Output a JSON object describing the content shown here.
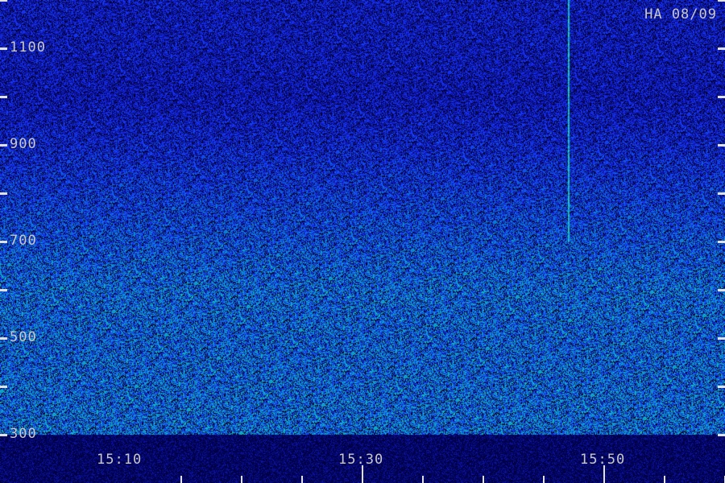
{
  "station_label": "HA 08/09",
  "chart_data": {
    "type": "heatmap",
    "title": "",
    "xlabel": "",
    "ylabel": "",
    "y_ticks_labeled": [
      300,
      500,
      700,
      900,
      1100
    ],
    "y_ticks_all": [
      300,
      400,
      500,
      600,
      700,
      800,
      900,
      1000,
      1100,
      1200
    ],
    "ylim": [
      300,
      1200
    ],
    "x_ticks_labeled": [
      "15:10",
      "15:30",
      "15:50"
    ],
    "x_ticks_minutes": [
      15.0,
      20.0,
      25.0,
      30.0,
      35.0,
      40.0,
      45.0,
      50.0,
      55.0,
      60.0
    ],
    "xlim": [
      "15:00",
      "16:00"
    ],
    "colormap": [
      "#000050",
      "#1a2cff",
      "#0a7fd8",
      "#13c9b8",
      "#1ff28a"
    ],
    "background_color": "#000033",
    "intensity_profile": [
      {
        "y": 1200,
        "level": 0.35
      },
      {
        "y": 1100,
        "level": 0.35
      },
      {
        "y": 1000,
        "level": 0.33
      },
      {
        "y": 900,
        "level": 0.4
      },
      {
        "y": 800,
        "level": 0.5
      },
      {
        "y": 700,
        "level": 0.6
      },
      {
        "y": 600,
        "level": 0.7
      },
      {
        "y": 500,
        "level": 0.68
      },
      {
        "y": 400,
        "level": 0.7
      },
      {
        "y": 300,
        "level": 0.72
      }
    ],
    "features": [
      {
        "type": "vertical_line",
        "time": "15:47",
        "y_range": [
          700,
          1200
        ]
      }
    ]
  }
}
